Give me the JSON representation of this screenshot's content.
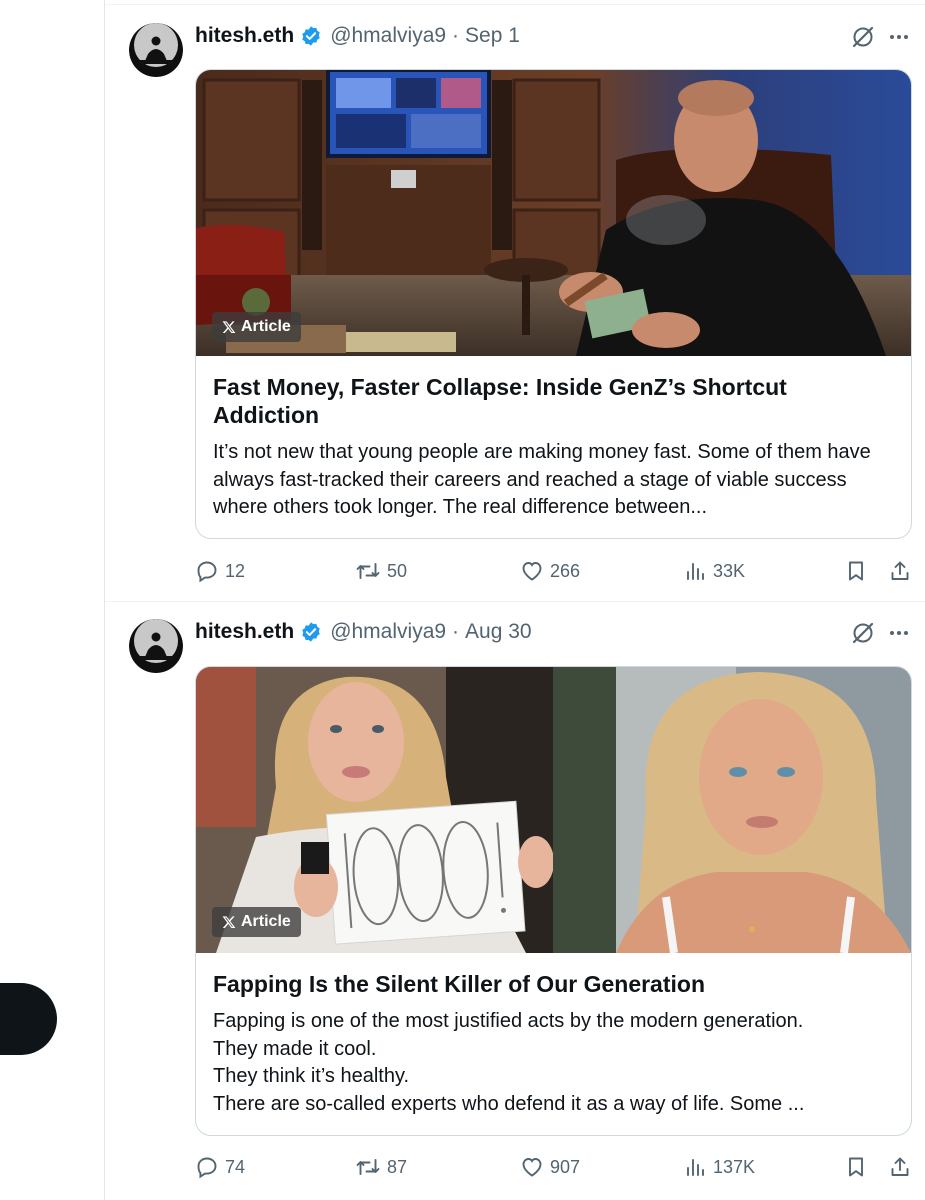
{
  "posts": [
    {
      "author": {
        "name": "hitesh.eth",
        "handle": "@hmalviya9",
        "separator": "·",
        "date": "Sep 1"
      },
      "article": {
        "badge": "Article",
        "title": "Fast Money, Faster Collapse: Inside GenZ’s Shortcut Addiction",
        "description": "It’s not new that young people are making money fast. Some of them have always fast-tracked their careers and reached a stage of viable success where others took longer. The real difference between..."
      },
      "stats": {
        "replies": "12",
        "reposts": "50",
        "likes": "266",
        "views": "33K"
      }
    },
    {
      "author": {
        "name": "hitesh.eth",
        "handle": "@hmalviya9",
        "separator": "·",
        "date": "Aug 30"
      },
      "article": {
        "badge": "Article",
        "title": "Fapping Is the Silent Killer of Our Generation",
        "description": "Fapping is one of the most justified acts by the modern generation.\nThey made it cool.\nThey think it’s healthy.\nThere are so-called experts who defend it as a way of life. Some ...",
        "sign_text": "1000!"
      },
      "stats": {
        "replies": "74",
        "reposts": "87",
        "likes": "907",
        "views": "137K"
      }
    }
  ],
  "colors": {
    "verified_blue": "#1d9bf0",
    "muted_text": "#536471",
    "border": "#cfd9de",
    "text": "#0f1419"
  },
  "icons": [
    "verified-badge-icon",
    "grok-icon",
    "more-icon",
    "reply-icon",
    "repost-icon",
    "like-icon",
    "views-icon",
    "bookmark-icon",
    "share-icon",
    "x-logo-icon"
  ]
}
